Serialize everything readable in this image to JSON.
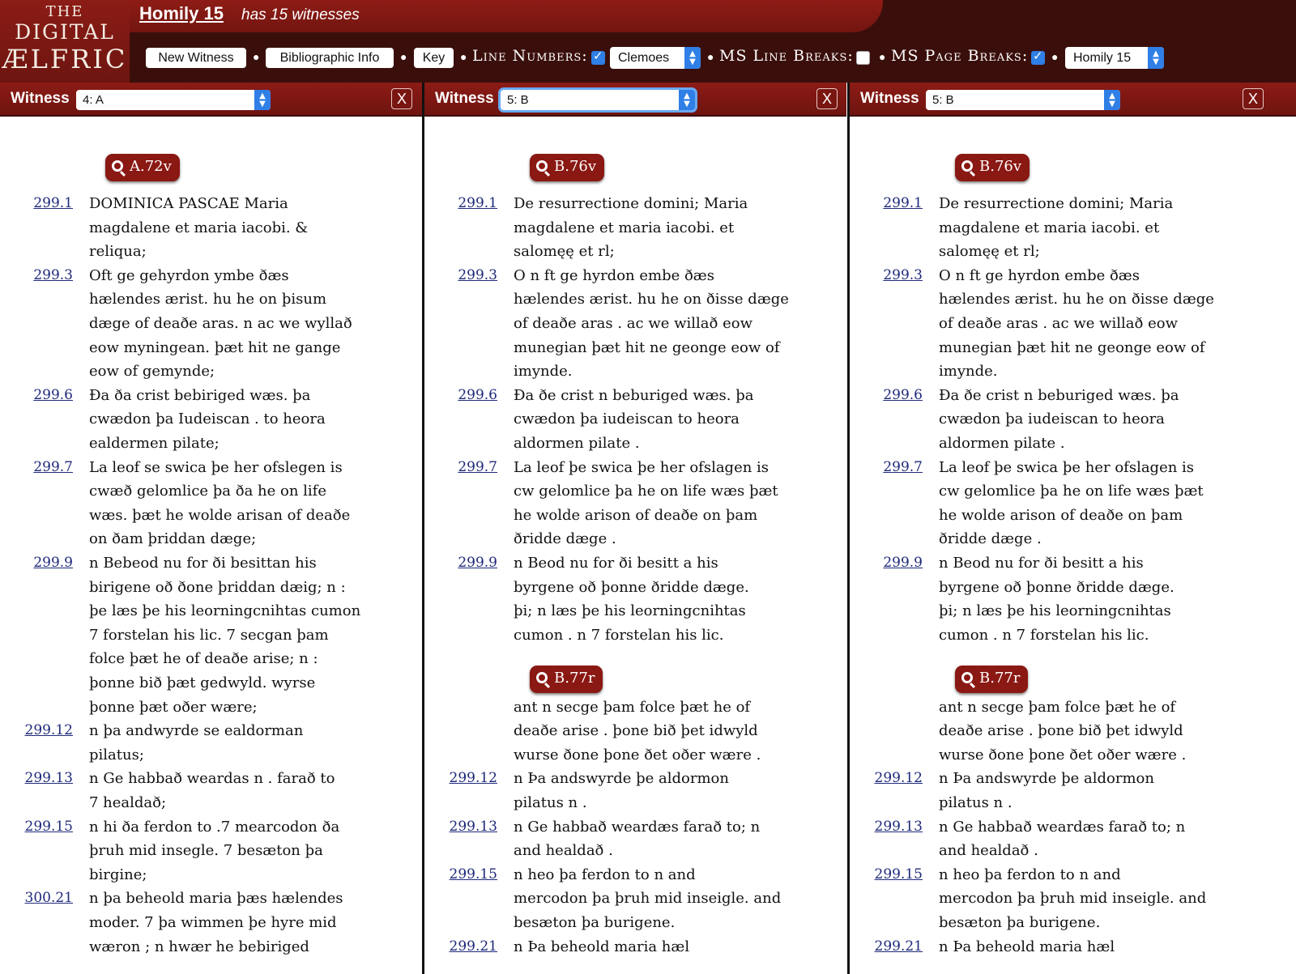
{
  "logo": {
    "line1": "THE",
    "line2": "DIGITAL",
    "line3": "ÆLFRIC"
  },
  "homily": {
    "title": "Homily 15",
    "subtitle": "has 15 witnesses"
  },
  "toolbar": {
    "new_witness": "New Witness",
    "bibliographic_info": "Bibliographic Info",
    "key": "Key",
    "line_numbers_label": "Line Numbers:",
    "line_numbers_checked": true,
    "numbering_select": "Clemoes",
    "ms_line_breaks_label": "MS Line Breaks:",
    "ms_line_breaks_checked": false,
    "ms_page_breaks_label": "MS Page Breaks:",
    "ms_page_breaks_checked": true,
    "homily_select": "Homily 15"
  },
  "witness_label": "Witness",
  "close_label": "X",
  "colors": {
    "red": "#d31f1f",
    "green": "#2a7d2a",
    "link": "#1f2a7a",
    "maroon": "#8a1813"
  },
  "columns": [
    {
      "witness": "4: A",
      "folios": [
        "A.72v"
      ],
      "line_numbers": [
        "299.1",
        "299.3",
        "299.6",
        "299.7",
        "299.9",
        "299.12",
        "299.13",
        "299.15",
        "300.21"
      ],
      "lines": [
        "DOMINICA PASCAE Maria",
        "magdalene et maria iacobi. &",
        "reliqua;",
        "Oft ge gehyrdon ymbe ðæs",
        "hælendes ærist. hu he on þisum",
        "dæge of deaðe aras. n ac we wyllað",
        "eow myningean. þæt hit ne gange",
        "eow of gemynde;",
        "Ða ða crist bebiriged wæs. þa",
        "cwædon þa Iudeiscan . to heora",
        "ealdermen pilate;",
        "La leof se swica þe her ofslegen is",
        "cwæð gelomlice þa ða he on life",
        "wæs. þæt he wolde arisan of deaðe",
        "on ðam þriddan dæge;",
        "n Bebeod nu for ði besittan his",
        "birigene oð ðone þriddan dæig; n :",
        "þe læs þe his leorningcnihtas cumon",
        "7 forstelan his lic. 7 secgan þam",
        "folce þæt he of deaðe arise; n :",
        "þonne bið þæt gedwyld. wyrse",
        "þonne þæt oðer wære;",
        "n þa andwyrde se ealdorman",
        "pilatus;",
        "n Ge habbað weardas n . farað to",
        "7 healdað;",
        "n hi ða ferdon to .7 mearcodon ða",
        "þruh mid insegle. 7 besæton þa",
        "birgine;",
        "n þa beheold maria þæs hælendes",
        "moder. 7 þa wimmen þe hyre mid",
        "wæron ; n hwær he bebiriged"
      ]
    },
    {
      "witness": "5: B",
      "folios": [
        "B.76v",
        "B.77r"
      ],
      "line_numbers": [
        "299.1",
        "299.3",
        "299.6",
        "299.7",
        "299.9",
        "299.12",
        "299.13",
        "299.15",
        "299.21"
      ],
      "lines": [
        "De resurrectione domini; Maria",
        "magdalene et maria iacobi. et",
        "salomęę et rl;",
        "O n ft ge hyrdon embe ðæs",
        "hælendes ærist. hu he on ðisse dæge",
        "of deaðe aras . ac we willað eow",
        "munegian þæt hit ne geonge eow of",
        "imynde.",
        "Ða ðe crist n beburiged wæs. þa",
        "cwædon þa iudeiscan to heora",
        "aldormen pilate .",
        "La leof þe swica þe her ofslagen is",
        "cw gelomlice þa he on life wæs þæt",
        "he wolde arison of deaðe on þam",
        "ðridde dæge .",
        "n Beod nu for ði besitt a his",
        "byrgene oð þonne ðridde dæge.",
        "þi; n læs þe his leorningcnihtas",
        "cumon . n 7 forstelan his lic.",
        "ant n secge þam folce þæt he of",
        "deaðe arise . þone bið þet idwyld",
        "wurse ðone þone ðet oðer wære .",
        "n Þa andswyrde þe aldormon",
        "pilatus n .",
        "n Ge habbað weardæs farað to; n",
        "and healdað .",
        "n heo þa ferdon to n and",
        "mercodon þa þruh mid inseigle. and",
        "besæton þa burigene.",
        "n Þa beheold maria hæl"
      ]
    },
    {
      "witness": "5: B",
      "folios": [
        "B.76v",
        "B.77r"
      ],
      "line_numbers": [
        "299.1",
        "299.3",
        "299.6",
        "299.7",
        "299.9",
        "299.12",
        "299.13",
        "299.15",
        "299.21"
      ],
      "lines": [
        "De resurrectione domini; Maria",
        "magdalene et maria iacobi. et",
        "salomęę et rl;",
        "O n ft ge hyrdon embe ðæs",
        "hælendes ærist. hu he on ðisse dæge",
        "of deaðe aras . ac we willað eow",
        "munegian þæt hit ne geonge eow of",
        "imynde.",
        "Ða ðe crist n beburiged wæs. þa",
        "cwædon þa iudeiscan to heora",
        "aldormen pilate .",
        "La leof þe swica þe her ofslagen is",
        "cw gelomlice þa he on life wæs þæt",
        "he wolde arison of deaðe on þam",
        "ðridde dæge .",
        "n Beod nu for ði besitt a his",
        "byrgene oð þonne ðridde dæge.",
        "þi; n læs þe his leorningcnihtas",
        "cumon . n 7 forstelan his lic.",
        "ant n secge þam folce þæt he of",
        "deaðe arise . þone bið þet idwyld",
        "wurse ðone þone ðet oðer wære .",
        "n Þa andswyrde þe aldormon",
        "pilatus n .",
        "n Ge habbað weardæs farað to; n",
        "and healdað .",
        "n heo þa ferdon to n and",
        "mercodon þa þruh mid inseigle. and",
        "besæton þa burigene.",
        "n Þa beheold maria hæl"
      ]
    }
  ]
}
